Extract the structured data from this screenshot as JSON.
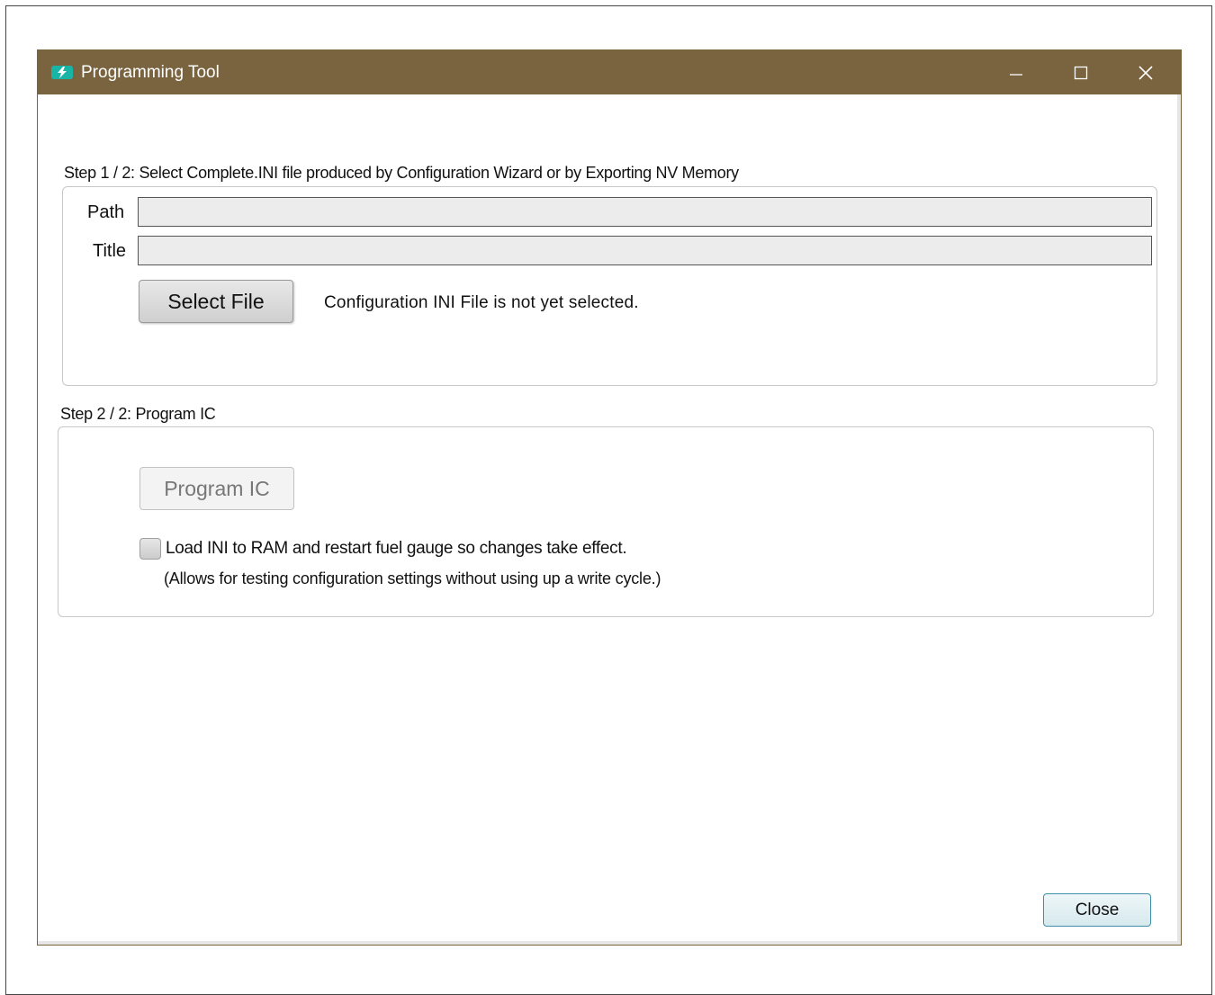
{
  "window": {
    "title": "Programming Tool",
    "accent_color": "#7a6440",
    "icon": "app-logo-icon"
  },
  "step1": {
    "heading": "Step 1 / 2: Select Complete.INI file produced by Configuration Wizard or by Exporting NV Memory",
    "path_label": "Path",
    "path_value": "",
    "title_label": "Title",
    "title_value": "",
    "select_button": "Select File",
    "status": "Configuration INI File is not yet selected."
  },
  "step2": {
    "heading": "Step 2 / 2: Program IC",
    "program_button": "Program IC",
    "load_ram_checkbox": {
      "label": "Load INI to RAM and restart fuel gauge so changes take effect.",
      "checked": false
    },
    "note": "(Allows for testing configuration settings without using up a write cycle.)"
  },
  "footer": {
    "close_button": "Close"
  }
}
